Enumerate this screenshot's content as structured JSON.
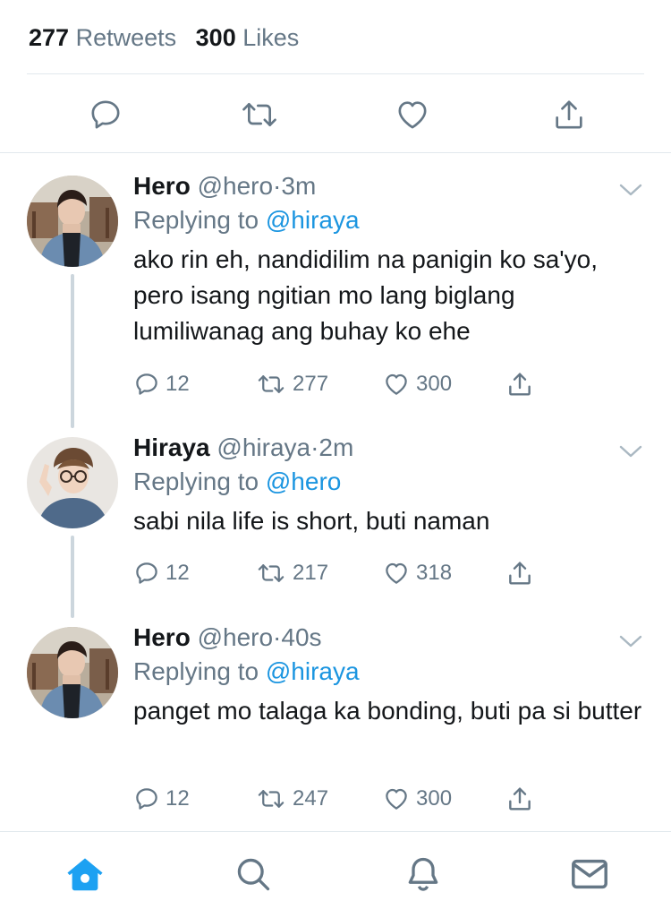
{
  "stats": {
    "retweets_count": "277",
    "retweets_label": "Retweets",
    "likes_count": "300",
    "likes_label": "Likes"
  },
  "main_actions": [
    "reply-icon",
    "retweet-icon",
    "like-icon",
    "share-icon"
  ],
  "tweets": [
    {
      "name": "Hero",
      "handle": "@hero",
      "separator": "·",
      "time": "3m",
      "replying_prefix": "Replying to",
      "replying_to": "@hiraya",
      "text": "ako rin eh, nandidilim na panigin ko sa'yo, pero isang ngitian mo lang biglang lumiliwanag ang buhay ko ehe",
      "replies": "12",
      "retweets": "277",
      "likes": "300"
    },
    {
      "name": "Hiraya",
      "handle": "@hiraya",
      "separator": "·",
      "time": "2m",
      "replying_prefix": "Replying to",
      "replying_to": "@hero",
      "text": "sabi nila life is short, buti naman",
      "replies": "12",
      "retweets": "217",
      "likes": "318"
    },
    {
      "name": "Hero",
      "handle": "@hero",
      "separator": "·",
      "time": "40s",
      "replying_prefix": "Replying to",
      "replying_to": "@hiraya",
      "text": "panget mo talaga ka bonding, buti pa si butter",
      "replies": "12",
      "retweets": "247",
      "likes": "300"
    }
  ],
  "colors": {
    "accent": "#1da1f2",
    "mention": "#1b95e0",
    "secondary_text": "#657786",
    "divider": "#e1e8ed",
    "thread_line": "#ccd6dd"
  },
  "bottom_nav": [
    "home-icon",
    "search-icon",
    "notifications-icon",
    "messages-icon"
  ]
}
